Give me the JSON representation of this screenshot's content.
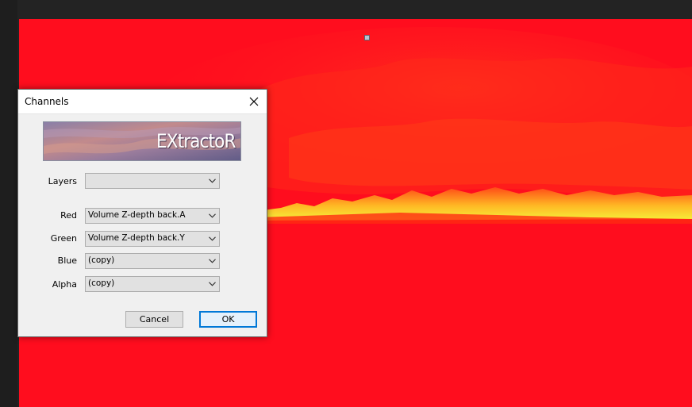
{
  "dialog": {
    "title": "Channels",
    "banner_text": "EXtractoR",
    "layers": {
      "label": "Layers",
      "value": ""
    },
    "channels": [
      {
        "key": "red",
        "label": "Red",
        "value": "Volume Z-depth back.A"
      },
      {
        "key": "green",
        "label": "Green",
        "value": "Volume Z-depth back.Y"
      },
      {
        "key": "blue",
        "label": "Blue",
        "value": "(copy)"
      },
      {
        "key": "alpha",
        "label": "Alpha",
        "value": "(copy)"
      }
    ],
    "cancel_label": "Cancel",
    "ok_label": "OK"
  },
  "colors": {
    "viewer_red": "#ff0d1e",
    "horizon_yellow": "#f5e03a",
    "accent_blue": "#0078d7"
  },
  "icons": [
    "close-icon",
    "chevron-down-icon"
  ]
}
